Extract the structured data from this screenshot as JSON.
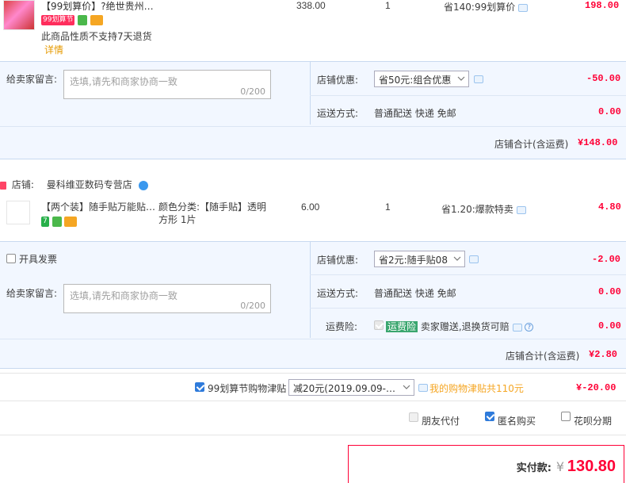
{
  "item1": {
    "title": "【99划算价】?绝世贵州…",
    "price": "338.00",
    "qty": "1",
    "discount": "省140:99划算价",
    "total": "198.00",
    "promo_badge": "99划算节",
    "note": "此商品性质不支持7天退货",
    "detail_link": "详情"
  },
  "shop1": {
    "message_label": "给卖家留言:",
    "message_placeholder": "选填,请先和商家协商一致",
    "message_count": "0/200",
    "promo_label": "店铺优惠:",
    "promo_select": "省50元:组合优惠",
    "promo_amount": "-50.00",
    "shipping_label": "运送方式:",
    "shipping_value": "普通配送 快递 免邮",
    "shipping_amount": "0.00",
    "subtotal_label": "店铺合计(含运费)",
    "subtotal_value": "¥148.00"
  },
  "shop2": {
    "shop_label": "店铺:",
    "shop_name": "曼科维亚数码专营店",
    "item_title": "【两个装】随手贴万能贴…",
    "item_spec_line1": "颜色分类:【随手贴】透明",
    "item_spec_line2": "方形 1片",
    "item_price": "6.00",
    "item_qty": "1",
    "item_discount": "省1.20:爆款特卖",
    "item_total": "4.80",
    "invoice_label": "开具发票",
    "promo_label": "店铺优惠:",
    "promo_select": "省2元:随手贴08",
    "promo_amount": "-2.00",
    "message_label": "给卖家留言:",
    "message_placeholder": "选填,请先和商家协商一致",
    "message_count": "0/200",
    "shipping_label": "运送方式:",
    "shipping_value": "普通配送 快递 免邮",
    "shipping_amount": "0.00",
    "insurance_label": "运费险:",
    "insurance_badge": "运费险",
    "insurance_text": "卖家赠送,退换货可赔",
    "insurance_amount": "0.00",
    "subtotal_label": "店铺合计(含运费)",
    "subtotal_value": "¥2.80"
  },
  "allowance": {
    "checkbox_label": "99划算节购物津贴",
    "select_value": "减20元(2019.09.09-…",
    "link_text": "我的购物津贴共110元",
    "amount": "¥-20.00"
  },
  "options": {
    "friend_pay": "朋友代付",
    "anonymous": "匿名购买",
    "huabei": "花呗分期"
  },
  "payment": {
    "label": "实付款:",
    "currency": "¥",
    "amount": "130.80"
  },
  "colors": {
    "accent_red": "#ff0036",
    "panel_blue": "#f2f7ff",
    "checkbox_blue": "#2f7bdb"
  }
}
